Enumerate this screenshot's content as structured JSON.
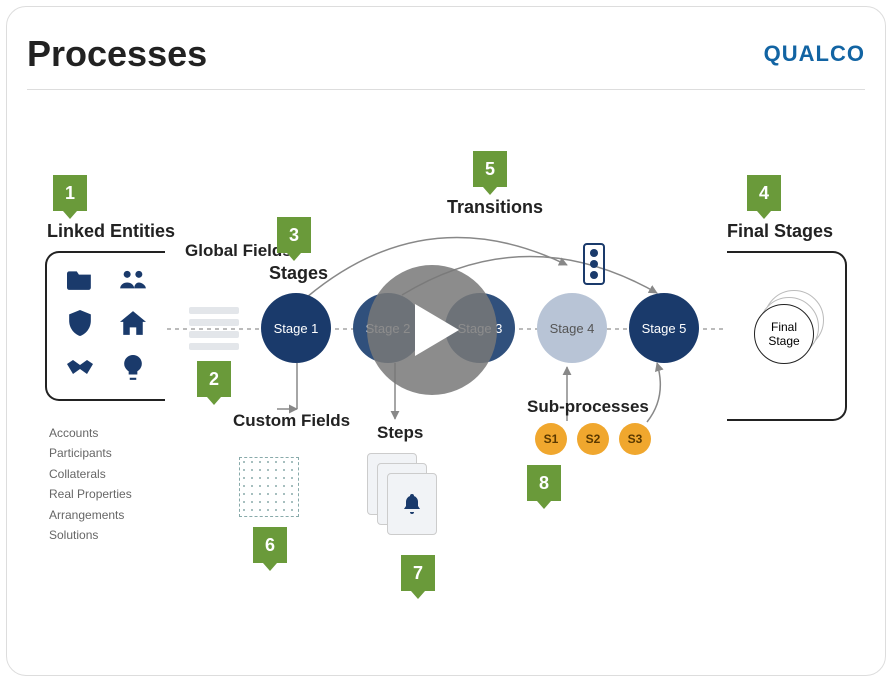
{
  "header": {
    "title": "Processes",
    "brand": "QUALCO"
  },
  "badges": {
    "linked": "1",
    "global": "2",
    "stages": "3",
    "final": "4",
    "transitions": "5",
    "custom": "6",
    "steps": "7",
    "sub": "8"
  },
  "labels": {
    "linked": "Linked Entities",
    "global": "Global Fields",
    "stages": "Stages",
    "final": "Final Stages",
    "transitions": "Transitions",
    "custom": "Custom Fields",
    "steps": "Steps",
    "sub": "Sub-processes"
  },
  "linked_entities": {
    "list": [
      "Accounts",
      "Participants",
      "Collaterals",
      "Real Properties",
      "Arrangements",
      "Solutions"
    ]
  },
  "stages": {
    "s1": "Stage 1",
    "s2": "Stage 2",
    "s3": "Stage 3",
    "s4": "Stage 4",
    "s5": "Stage 5"
  },
  "final_stage": "Final Stage",
  "sub_processes": {
    "s1": "S1",
    "s2": "S2",
    "s3": "S3"
  }
}
